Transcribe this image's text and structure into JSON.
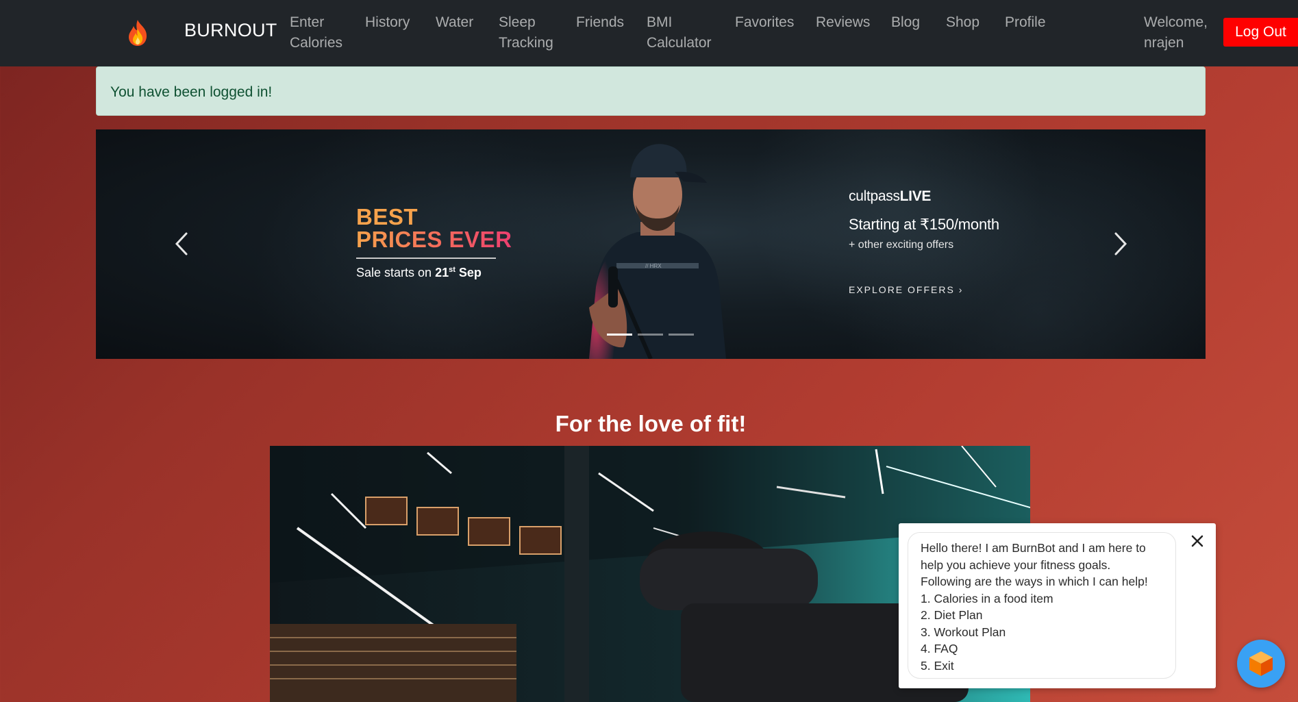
{
  "navbar": {
    "brand": "BURNOUT",
    "links": [
      {
        "label": "Enter\nCalories"
      },
      {
        "label": "History"
      },
      {
        "label": "Water"
      },
      {
        "label": "Sleep\nTracking"
      },
      {
        "label": "Friends"
      },
      {
        "label": "BMI\nCalculator"
      },
      {
        "label": "Favorites"
      },
      {
        "label": "Reviews"
      },
      {
        "label": "Blog"
      },
      {
        "label": "Shop"
      },
      {
        "label": "Profile"
      }
    ],
    "welcome": "Welcome,\nnrajen",
    "logout_label": "Log Out"
  },
  "alert": {
    "message": "You have been logged in!"
  },
  "carousel": {
    "slide": {
      "headline_line1": "BEST",
      "headline_line2": "PRICES EVER",
      "sale_prefix": "Sale starts on ",
      "sale_date": "21",
      "sale_suffix": "st",
      "sale_month": " Sep",
      "brand_light": "cultpass",
      "brand_bold": "LIVE",
      "price_text": "Starting at ₹150/month",
      "offers_text": "+ other exciting offers",
      "cta": "EXPLORE OFFERS ›",
      "shirt_text": "// HRX"
    },
    "active_index": 0,
    "slide_count": 3
  },
  "section": {
    "title": "For the love of fit!"
  },
  "chatbot": {
    "lines": [
      "Hello there! I am BurnBot and I am here to",
      "help you achieve your fitness goals.",
      "Following are the ways in which I can help!",
      "1. Calories in a food item",
      "2. Diet Plan",
      "3. Workout Plan",
      "4. FAQ",
      "5. Exit"
    ]
  },
  "colors": {
    "navbar_bg": "#212529",
    "logout_bg": "#ff0000",
    "alert_bg": "#d1e7dd",
    "alert_text": "#0f5132",
    "chat_launcher": "#39a1f4"
  }
}
